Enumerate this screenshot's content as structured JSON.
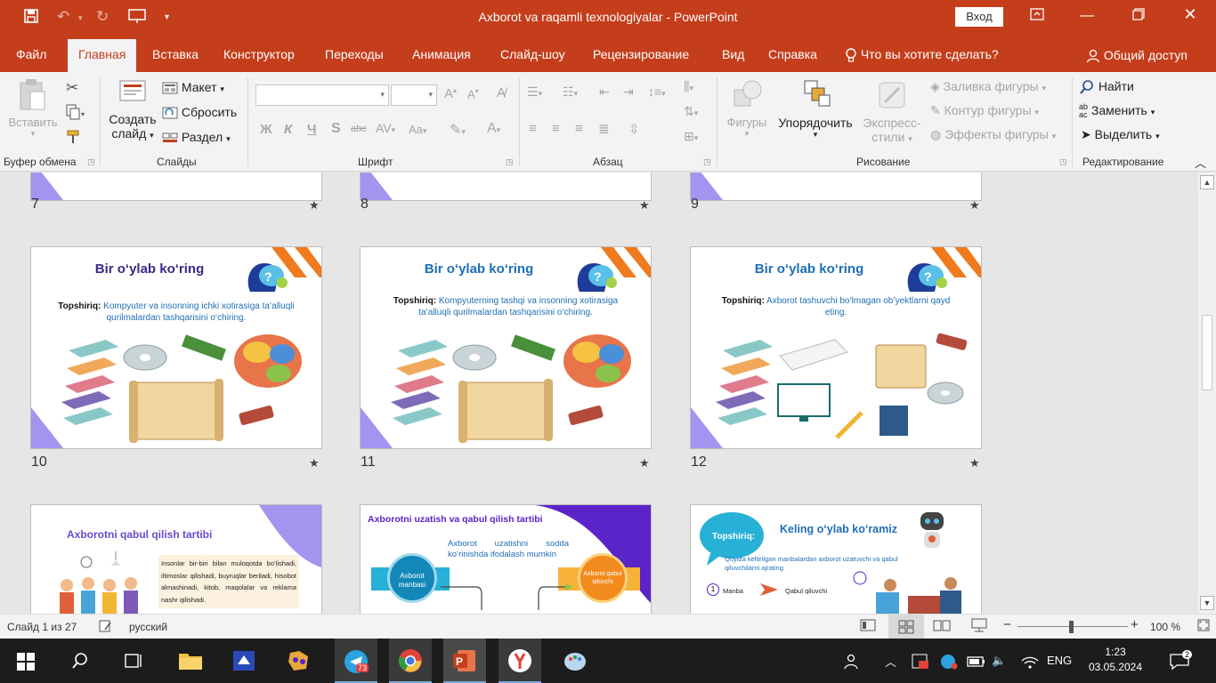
{
  "window": {
    "title": "Axborot va raqamli texnologiyalar  -  PowerPoint",
    "login": "Вход"
  },
  "tabs": [
    "Файл",
    "Главная",
    "Вставка",
    "Конструктор",
    "Переходы",
    "Анимация",
    "Слайд-шоу",
    "Рецензирование",
    "Вид",
    "Справка"
  ],
  "search": "Что вы хотите сделать?",
  "share": "Общий доступ",
  "ribbon": {
    "clipboard": {
      "paste": "Вставить",
      "label": "Буфер обмена"
    },
    "slides": {
      "new_slide_1": "Создать",
      "new_slide_2": "слайд",
      "layout": "Макет",
      "reset": "Сбросить",
      "section": "Раздел",
      "label": "Слайды"
    },
    "font": {
      "label": "Шрифт",
      "bold": "Ж",
      "italic": "К",
      "underline": "Ч",
      "shadow": "S",
      "strike": "abc",
      "aa": "Aa"
    },
    "paragraph": {
      "label": "Абзац"
    },
    "drawing": {
      "shapes": "Фигуры",
      "arrange": "Упорядочить",
      "quick_styles_1": "Экспресс-",
      "quick_styles_2": "стили",
      "fill": "Заливка фигуры",
      "outline": "Контур фигуры",
      "effects": "Эффекты фигуры",
      "label": "Рисование"
    },
    "editing": {
      "find": "Найти",
      "replace": "Заменить",
      "select": "Выделить",
      "label": "Редактирование"
    }
  },
  "slides_row_top": [
    "7",
    "8",
    "9"
  ],
  "slides": [
    {
      "num": "10",
      "title": "Bir o‘ylab ko‘ring",
      "task_bold": "Topshiriq:",
      "task": " Kompyuter va insonning ichki xotirasiga ta’alluqli qurilmalardan tashqarisini o‘chiring."
    },
    {
      "num": "11",
      "title": "Bir o‘ylab ko‘ring",
      "task_bold": "Topshiriq:",
      "task": " Kompyuterning tashqi va insonning xotirasiga ta’alluqli qurilmalardan tashqarisini o‘chiring."
    },
    {
      "num": "12",
      "title": "Bir o‘ylab ko‘ring",
      "task_bold": "Topshiriq:",
      "task": " Axborot tashuvchi bo‘lmagan ob’yektlarni qayd eting."
    }
  ],
  "slides_bottom": {
    "s13": {
      "title": "Axborotni qabul qilish tartibi",
      "text": "Insonlar bir-biri bilan muloqotda bo‘lishadi, iltimoslar qilishadi, buyruqlar beriladi, hisobot almashinadi, kitob, maqolalar va reklama nashr qilishadi."
    },
    "s14": {
      "title": "Axborotni uzatish va qabul qilish tartibi",
      "text": "Axborot uzatishni sodda ko‘rinishda ifodalash mumkin",
      "left": "Axborot manbasi",
      "right": "Axborot qabul qiluvchi"
    },
    "s15": {
      "title": "Keling o‘ylab ko‘ramiz",
      "badge": "Topshiriq:",
      "text": "Quyida keltirilgan manbalardan axborot uzatuvchi va qabul qiluvchilarni ajrating.",
      "src": "Manba",
      "dst": "Qabul qiluvchi"
    }
  },
  "status": {
    "slide": "Слайд 1 из 27",
    "lang": "русский",
    "zoom": "100 %"
  },
  "taskbar": {
    "telegram_badge": "73",
    "time": "1:23",
    "date": "03.05.2024",
    "lang": "ENG",
    "notif": "2"
  }
}
